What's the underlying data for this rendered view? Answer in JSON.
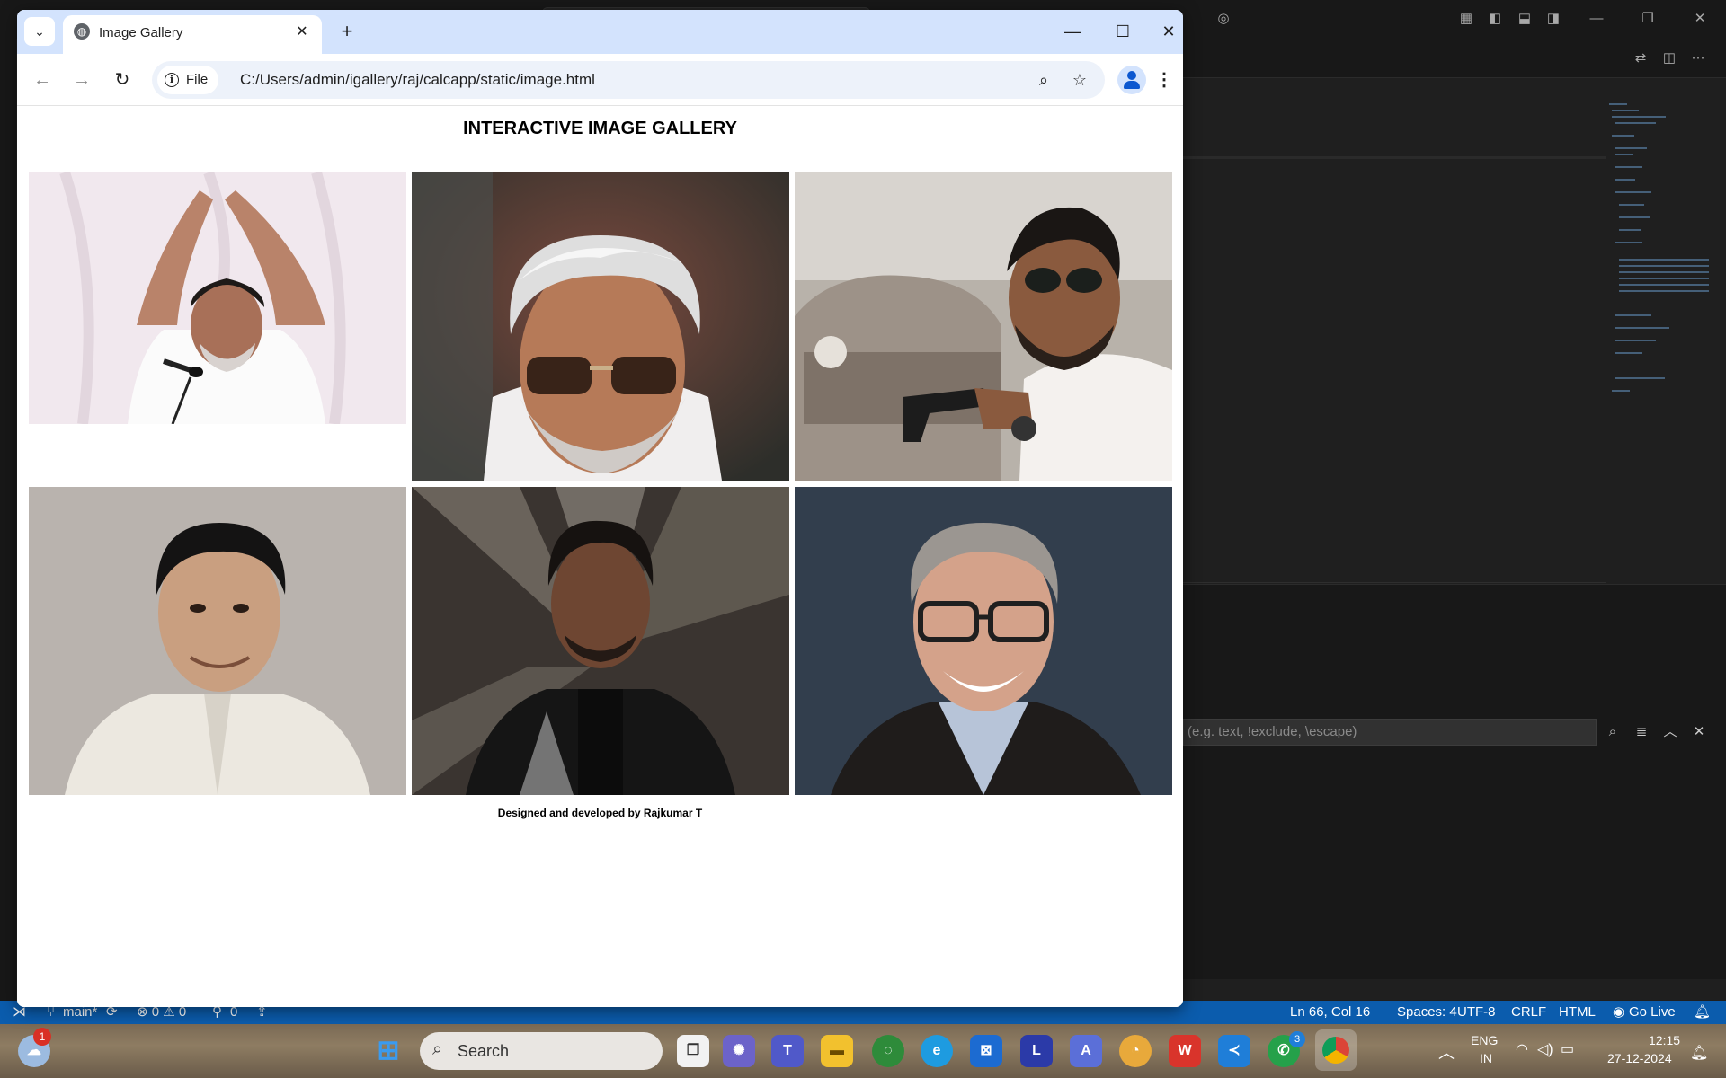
{
  "vscode": {
    "find_placeholder": "(e.g. text, !exclude, \\escape)",
    "status": {
      "branch": "main*",
      "problems": "⊗ 0 ⚠ 0",
      "ports": "0",
      "cursor": "Ln 66, Col 16",
      "spaces": "Spaces: 4",
      "encoding": "UTF-8",
      "eol": "CRLF",
      "language": "HTML",
      "golive": "Go Live"
    }
  },
  "taskbar": {
    "search_text": "Search",
    "weather_badge": "1",
    "language_line1": "ENG",
    "language_line2": "IN",
    "time": "12:15",
    "date": "27-12-2024",
    "whatsapp_badge": "3"
  },
  "browser": {
    "tab_title": "Image Gallery",
    "chip_label": "File",
    "url": "C:/Users/admin/igallery/raj/calcapp/static/image.html"
  },
  "page": {
    "title": "INTERACTIVE IMAGE GALLERY",
    "credit": "Designed and developed by Rajkumar T",
    "photos": [
      {
        "alt": "man in white shirt with folded hands at microphone"
      },
      {
        "alt": "illustrated portrait of silver-haired man in sunglasses"
      },
      {
        "alt": "bearded man in sunglasses holding a pistol near vintage car"
      },
      {
        "alt": "smiling man in white jacket"
      },
      {
        "alt": "man in black embellished jacket"
      },
      {
        "alt": "smiling man in glasses"
      }
    ]
  }
}
